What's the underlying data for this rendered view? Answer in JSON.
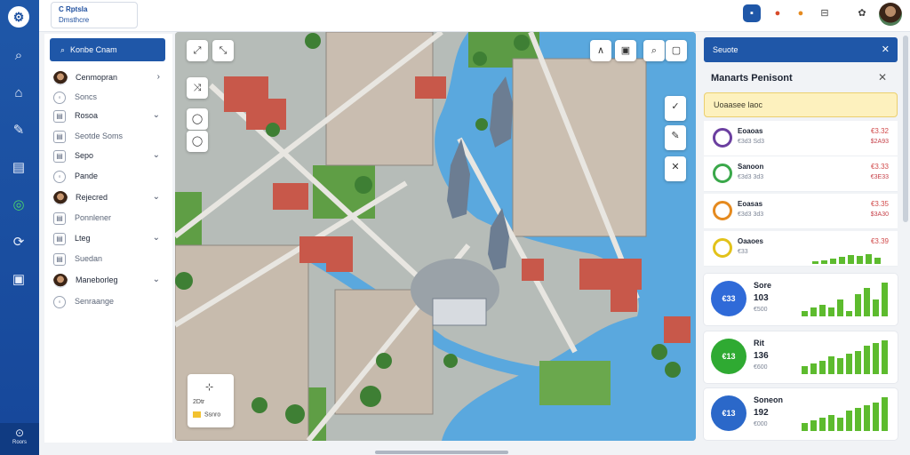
{
  "rail": {
    "logo": "⚙",
    "icons": [
      "search-icon",
      "home-icon",
      "tag-icon",
      "book-icon",
      "target-icon",
      "bell-icon",
      "layers-icon"
    ],
    "footer_label": "Roors"
  },
  "topbar": {
    "brand_title": "C Rptsla",
    "brand_sub": "Dmsthcre"
  },
  "left_panel": {
    "header": "Konbe Cnam",
    "items": [
      {
        "label": "Cenmopran",
        "icon": "avatar",
        "chevron": "›",
        "sub": false
      },
      {
        "label": "Soncs",
        "icon": "badge",
        "chevron": "",
        "sub": true
      },
      {
        "label": "Rosoa",
        "icon": "doc",
        "chevron": "⌄",
        "sub": false
      },
      {
        "label": "Seotde Soms",
        "icon": "doc",
        "chevron": "",
        "sub": true
      },
      {
        "label": "Sepo",
        "icon": "doc",
        "chevron": "⌄",
        "sub": false
      },
      {
        "label": "Pande",
        "icon": "round",
        "chevron": "",
        "sub": false
      },
      {
        "label": "Rejecred",
        "icon": "avatar",
        "chevron": "⌄",
        "sub": false
      },
      {
        "label": "Ponnlener",
        "icon": "doc",
        "chevron": "",
        "sub": true
      },
      {
        "label": "Lteg",
        "icon": "doc",
        "chevron": "⌄",
        "sub": false
      },
      {
        "label": "Suedan",
        "icon": "doc",
        "chevron": "",
        "sub": true
      },
      {
        "label": "Maneborleg",
        "icon": "avatar",
        "chevron": "⌄",
        "sub": false
      },
      {
        "label": "Senraange",
        "icon": "round",
        "chevron": "",
        "sub": true
      }
    ]
  },
  "map": {
    "legend_label": "Ssnro",
    "legend_label2": "2Dtr"
  },
  "right_panel": {
    "header": "Seuote",
    "title": "Manarts Penisont",
    "alert": "Uoaasee laoc",
    "metrics": [
      {
        "title": "Eoaoas",
        "sub": "€3d3 Sd3",
        "value": "€3.32",
        "value2": "$2A93",
        "ring_color": "#6b3fa0"
      },
      {
        "title": "Sanoon",
        "sub": "€3d3 3d3",
        "value": "€3.33",
        "value2": "€3E33",
        "ring_color": "#3aa84a"
      },
      {
        "title": "Eoasas",
        "sub": "€3d3 3d3",
        "value": "€3.35",
        "value2": "$3A30",
        "ring_color": "#e58a1f"
      }
    ],
    "mini": {
      "title": "Oaaoes",
      "sub": "€33",
      "value": "€3.39",
      "ring_color": "#e2c21a"
    },
    "cards": [
      {
        "gauge": "€33",
        "n1": "Sore",
        "n2": "103",
        "n3": "€500",
        "color": "#2f6ad8",
        "bars": [
          2,
          3,
          4,
          3,
          6,
          2,
          8,
          10,
          6,
          12
        ]
      },
      {
        "gauge": "€13",
        "n1": "Rit",
        "n2": "136",
        "n3": "€600",
        "color": "#2faa32",
        "bars": [
          3,
          4,
          5,
          7,
          6,
          8,
          9,
          11,
          12,
          13
        ]
      },
      {
        "gauge": "€13",
        "n1": "Soneon",
        "n2": "192",
        "n3": "€000",
        "color": "#2b68c9",
        "bars": [
          3,
          4,
          5,
          6,
          5,
          8,
          9,
          10,
          11,
          13
        ]
      }
    ]
  }
}
